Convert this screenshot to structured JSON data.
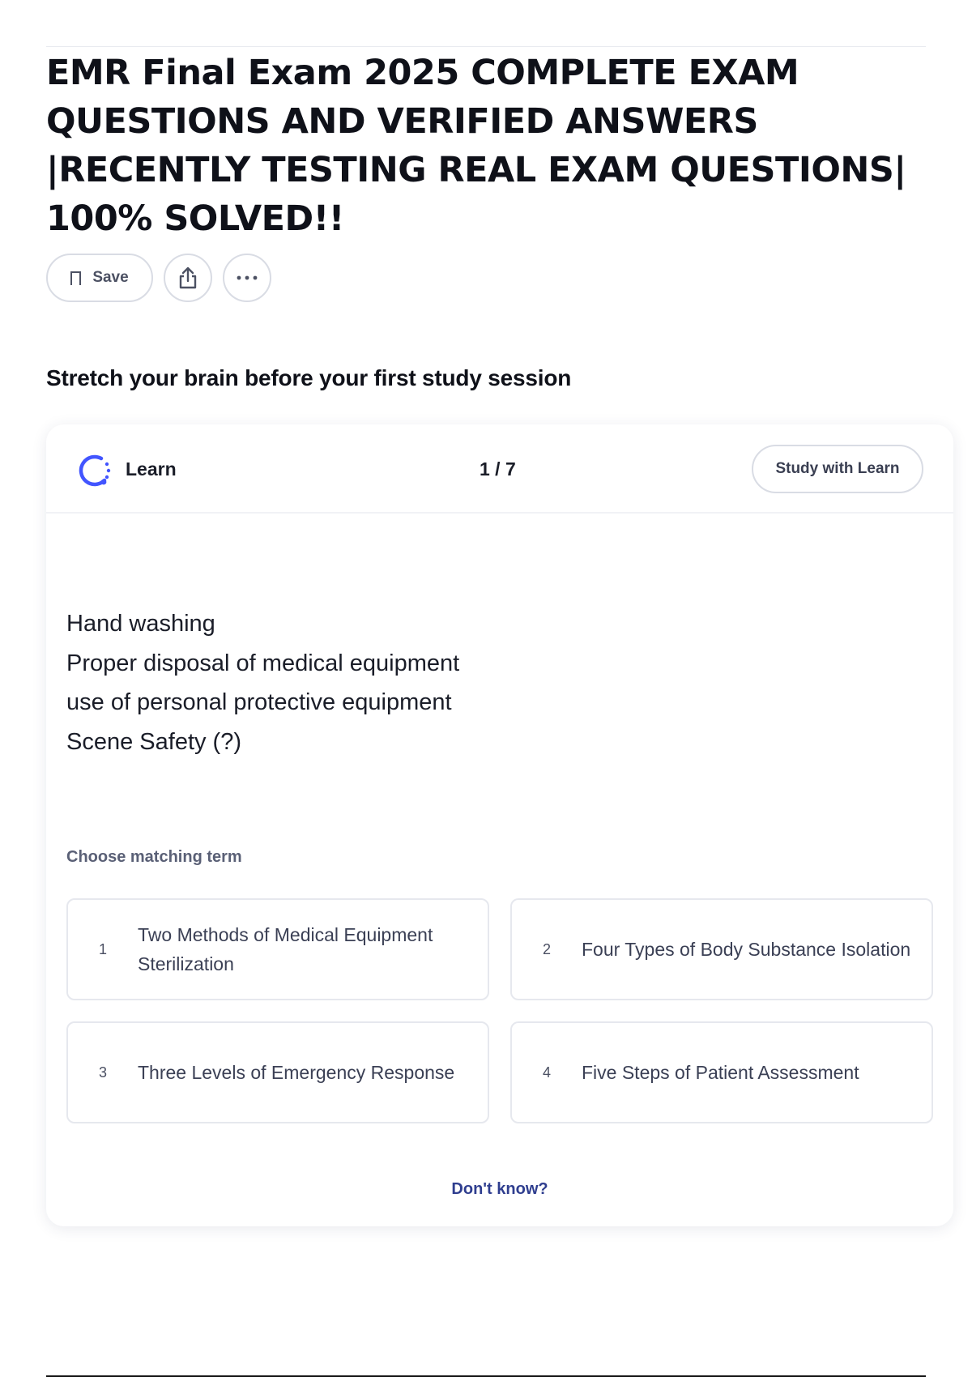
{
  "document": {
    "title": "EMR Final Exam 2025 COMPLETE EXAM QUESTIONS AND VERIFIED ANSWERS |RECENTLY TESTING REAL EXAM QUESTIONS| 100% SOLVED!!",
    "title_lines": [
      "EMR Final Exam 2025 COMPLETE EXAM",
      "QUESTIONS AND VERIFIED ANSWERS",
      "|RECENTLY TESTING REAL EXAM QUESTIONS|",
      "100% SOLVED!!"
    ]
  },
  "actions": {
    "save_label": "Save",
    "save_icon": "bookmark-icon",
    "share_icon": "share-icon",
    "more_icon": "more-horizontal-icon"
  },
  "section": {
    "heading": "Stretch your brain before your first study session"
  },
  "learn_card": {
    "mode_label": "Learn",
    "mode_icon": "learn-progress-icon",
    "progress": "1 / 7",
    "study_button": "Study with Learn",
    "definition_lines": [
      "Hand washing",
      "Proper disposal of medical equipment",
      "use of personal protective equipment",
      "Scene Safety (?)"
    ],
    "prompt": "Choose matching term",
    "options": [
      {
        "number": "1",
        "text": "Two Methods of Medical Equipment Sterilization"
      },
      {
        "number": "2",
        "text": "Four Types of Body Substance Isolation"
      },
      {
        "number": "3",
        "text": "Three Levels of Emergency Response"
      },
      {
        "number": "4",
        "text": "Five Steps of Patient Assessment"
      }
    ],
    "dont_know": "Don't know?"
  },
  "colors": {
    "accent": "#4255ff",
    "link": "#2f3e8f",
    "border": "#d9dce4"
  }
}
